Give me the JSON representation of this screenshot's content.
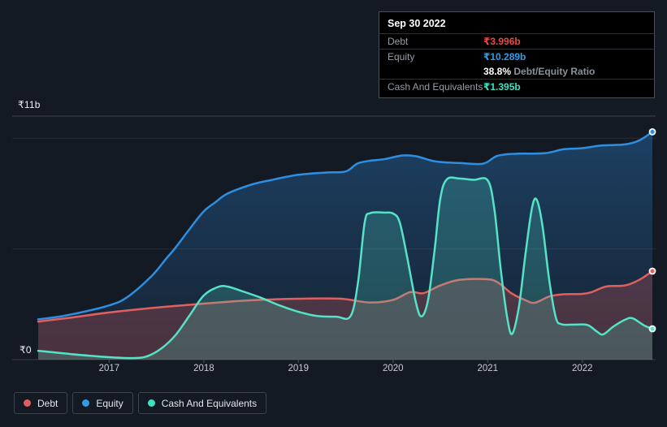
{
  "colors": {
    "debt": "#e25d5a",
    "equity": "#2e8ee0",
    "cash": "#52e2c6",
    "tooltip_debt_value": "#e84b45",
    "tooltip_equity_value": "#2f9ce8",
    "tooltip_cash_value": "#3fe0c4"
  },
  "tooltip": {
    "date": "Sep 30 2022",
    "debt_label": "Debt",
    "debt_value": "₹3.996b",
    "equity_label": "Equity",
    "equity_value": "₹10.289b",
    "ratio_value": "38.8%",
    "ratio_label": "Debt/Equity Ratio",
    "cash_label": "Cash And Equivalents",
    "cash_value": "₹1.395b"
  },
  "axis": {
    "y_top_label": "₹11b",
    "y_zero_label": "₹0",
    "x_ticks": [
      "2017",
      "2018",
      "2019",
      "2020",
      "2021",
      "2022"
    ]
  },
  "legend": {
    "items": [
      {
        "id": "debt",
        "label": "Debt",
        "color": "#e25d5a"
      },
      {
        "id": "equity",
        "label": "Equity",
        "color": "#2f9ce8"
      },
      {
        "id": "cash",
        "label": "Cash And Equivalents",
        "color": "#3fe0c4"
      }
    ]
  },
  "chart_data": {
    "type": "area",
    "x_unit": "year",
    "y_unit": "₹ billions",
    "ylim": [
      0,
      11
    ],
    "grid_values": [
      11,
      10,
      5
    ],
    "legend_position": "bottom-left",
    "series": [
      {
        "id": "equity",
        "name": "Equity",
        "z": 1,
        "color": "#2e8ee0",
        "fill": "gradient",
        "points": [
          [
            2016.25,
            1.82
          ],
          [
            2016.55,
            2.0
          ],
          [
            2017.0,
            2.45
          ],
          [
            2017.2,
            2.85
          ],
          [
            2017.45,
            3.78
          ],
          [
            2017.6,
            4.55
          ],
          [
            2017.7,
            5.05
          ],
          [
            2017.85,
            5.9
          ],
          [
            2018.0,
            6.7
          ],
          [
            2018.12,
            7.1
          ],
          [
            2018.25,
            7.5
          ],
          [
            2018.5,
            7.9
          ],
          [
            2018.7,
            8.1
          ],
          [
            2019.0,
            8.35
          ],
          [
            2019.3,
            8.45
          ],
          [
            2019.5,
            8.5
          ],
          [
            2019.62,
            8.85
          ],
          [
            2019.75,
            8.98
          ],
          [
            2019.9,
            9.05
          ],
          [
            2020.1,
            9.22
          ],
          [
            2020.25,
            9.18
          ],
          [
            2020.45,
            8.95
          ],
          [
            2020.7,
            8.88
          ],
          [
            2020.95,
            8.85
          ],
          [
            2021.1,
            9.2
          ],
          [
            2021.3,
            9.3
          ],
          [
            2021.6,
            9.32
          ],
          [
            2021.8,
            9.5
          ],
          [
            2022.0,
            9.55
          ],
          [
            2022.2,
            9.67
          ],
          [
            2022.45,
            9.72
          ],
          [
            2022.6,
            9.9
          ],
          [
            2022.74,
            10.289
          ]
        ]
      },
      {
        "id": "debt",
        "name": "Debt",
        "z": 2,
        "color": "#e06060",
        "fill": "rgba(224,92,92,0.26)",
        "points": [
          [
            2016.25,
            1.72
          ],
          [
            2016.6,
            1.9
          ],
          [
            2017.0,
            2.13
          ],
          [
            2017.5,
            2.35
          ],
          [
            2018.0,
            2.53
          ],
          [
            2018.5,
            2.68
          ],
          [
            2019.0,
            2.75
          ],
          [
            2019.45,
            2.75
          ],
          [
            2019.75,
            2.58
          ],
          [
            2020.0,
            2.7
          ],
          [
            2020.18,
            3.05
          ],
          [
            2020.32,
            3.0
          ],
          [
            2020.5,
            3.35
          ],
          [
            2020.7,
            3.6
          ],
          [
            2021.0,
            3.63
          ],
          [
            2021.12,
            3.45
          ],
          [
            2021.25,
            3.0
          ],
          [
            2021.4,
            2.68
          ],
          [
            2021.5,
            2.57
          ],
          [
            2021.65,
            2.85
          ],
          [
            2021.8,
            2.95
          ],
          [
            2022.0,
            2.97
          ],
          [
            2022.1,
            3.05
          ],
          [
            2022.25,
            3.3
          ],
          [
            2022.45,
            3.35
          ],
          [
            2022.6,
            3.6
          ],
          [
            2022.74,
            3.996
          ]
        ]
      },
      {
        "id": "cash",
        "name": "Cash And Equivalents",
        "z": 3,
        "color": "#55e2c7",
        "fill": "rgba(80,224,197,0.22)",
        "points": [
          [
            2016.25,
            0.4
          ],
          [
            2016.6,
            0.25
          ],
          [
            2017.0,
            0.11
          ],
          [
            2017.25,
            0.07
          ],
          [
            2017.4,
            0.15
          ],
          [
            2017.55,
            0.5
          ],
          [
            2017.7,
            1.1
          ],
          [
            2017.85,
            2.0
          ],
          [
            2018.0,
            2.9
          ],
          [
            2018.15,
            3.28
          ],
          [
            2018.25,
            3.3
          ],
          [
            2018.4,
            3.1
          ],
          [
            2018.6,
            2.8
          ],
          [
            2018.8,
            2.45
          ],
          [
            2019.0,
            2.16
          ],
          [
            2019.2,
            1.97
          ],
          [
            2019.4,
            1.94
          ],
          [
            2019.55,
            1.96
          ],
          [
            2019.63,
            3.5
          ],
          [
            2019.7,
            6.2
          ],
          [
            2019.76,
            6.62
          ],
          [
            2019.9,
            6.64
          ],
          [
            2020.0,
            6.6
          ],
          [
            2020.07,
            6.2
          ],
          [
            2020.15,
            4.6
          ],
          [
            2020.24,
            2.6
          ],
          [
            2020.3,
            1.95
          ],
          [
            2020.37,
            2.7
          ],
          [
            2020.44,
            5.0
          ],
          [
            2020.5,
            7.3
          ],
          [
            2020.57,
            8.15
          ],
          [
            2020.7,
            8.18
          ],
          [
            2020.85,
            8.12
          ],
          [
            2021.0,
            8.1
          ],
          [
            2021.07,
            6.8
          ],
          [
            2021.14,
            4.0
          ],
          [
            2021.21,
            1.8
          ],
          [
            2021.26,
            1.17
          ],
          [
            2021.33,
            2.4
          ],
          [
            2021.4,
            4.8
          ],
          [
            2021.47,
            6.9
          ],
          [
            2021.52,
            7.2
          ],
          [
            2021.58,
            6.0
          ],
          [
            2021.65,
            3.6
          ],
          [
            2021.72,
            1.9
          ],
          [
            2021.78,
            1.6
          ],
          [
            2021.9,
            1.58
          ],
          [
            2022.05,
            1.57
          ],
          [
            2022.15,
            1.28
          ],
          [
            2022.22,
            1.14
          ],
          [
            2022.33,
            1.5
          ],
          [
            2022.45,
            1.8
          ],
          [
            2022.53,
            1.87
          ],
          [
            2022.65,
            1.55
          ],
          [
            2022.74,
            1.395
          ]
        ]
      }
    ]
  }
}
